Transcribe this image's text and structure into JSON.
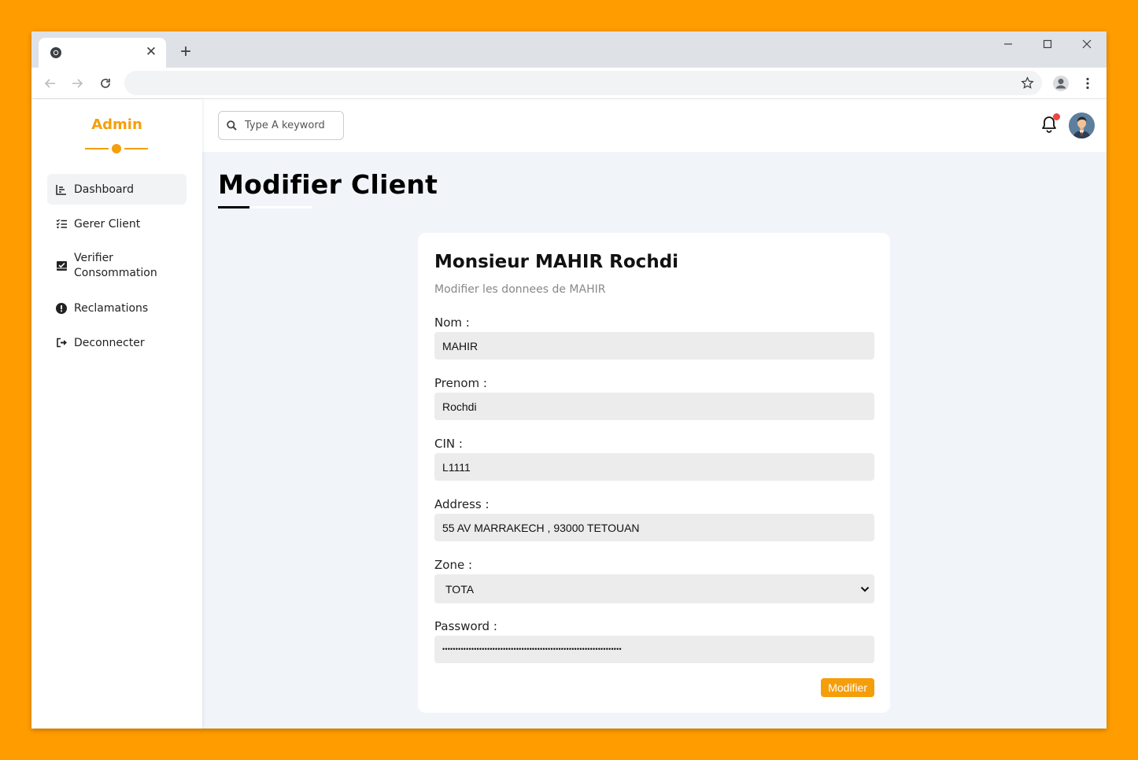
{
  "browser": {
    "tab_close": "✕",
    "new_tab": "+",
    "icons": [
      "chrome-favicon-icon",
      "back-arrow-icon",
      "forward-arrow-icon",
      "reload-icon",
      "star-icon",
      "profile-icon",
      "kebab-menu-icon",
      "minimize-icon",
      "maximize-icon",
      "close-window-icon"
    ]
  },
  "sidebar": {
    "brand": "Admin",
    "items": [
      {
        "label": "Dashboard",
        "icon": "chart-icon",
        "active": true
      },
      {
        "label": "Gerer Client",
        "icon": "list-check-icon"
      },
      {
        "label": "Verifier Consommation",
        "icon": "inbox-check-icon"
      },
      {
        "label": "Reclamations",
        "icon": "exclamation-icon"
      },
      {
        "label": "Deconnecter",
        "icon": "sign-out-icon"
      }
    ]
  },
  "topbar": {
    "search_placeholder": "Type A keyword",
    "has_notification": true
  },
  "page": {
    "title": "Modifier Client"
  },
  "form": {
    "heading": "Monsieur MAHIR Rochdi",
    "subtitle": "Modifier les donnees de MAHIR",
    "fields": [
      {
        "label": "Nom :",
        "value": "MAHIR"
      },
      {
        "label": "Prenom :",
        "value": "Rochdi"
      },
      {
        "label": "CIN :",
        "value": "L1111"
      },
      {
        "label": "Address :",
        "value": "55 AV MARRAKECH , 93000 TETOUAN"
      }
    ],
    "zone": {
      "label": "Zone :",
      "value": "TOTA"
    },
    "password": {
      "label": "Password :",
      "value": "••••••••••••••••••••••••••••••••••••••••••••••••••••••••••••••••••••"
    },
    "submit_label": "Modifier"
  },
  "colors": {
    "accent": "#f59e0b",
    "page_bg": "#ff9c00",
    "content_bg": "#f1f5f9",
    "notification": "#ef4444"
  }
}
